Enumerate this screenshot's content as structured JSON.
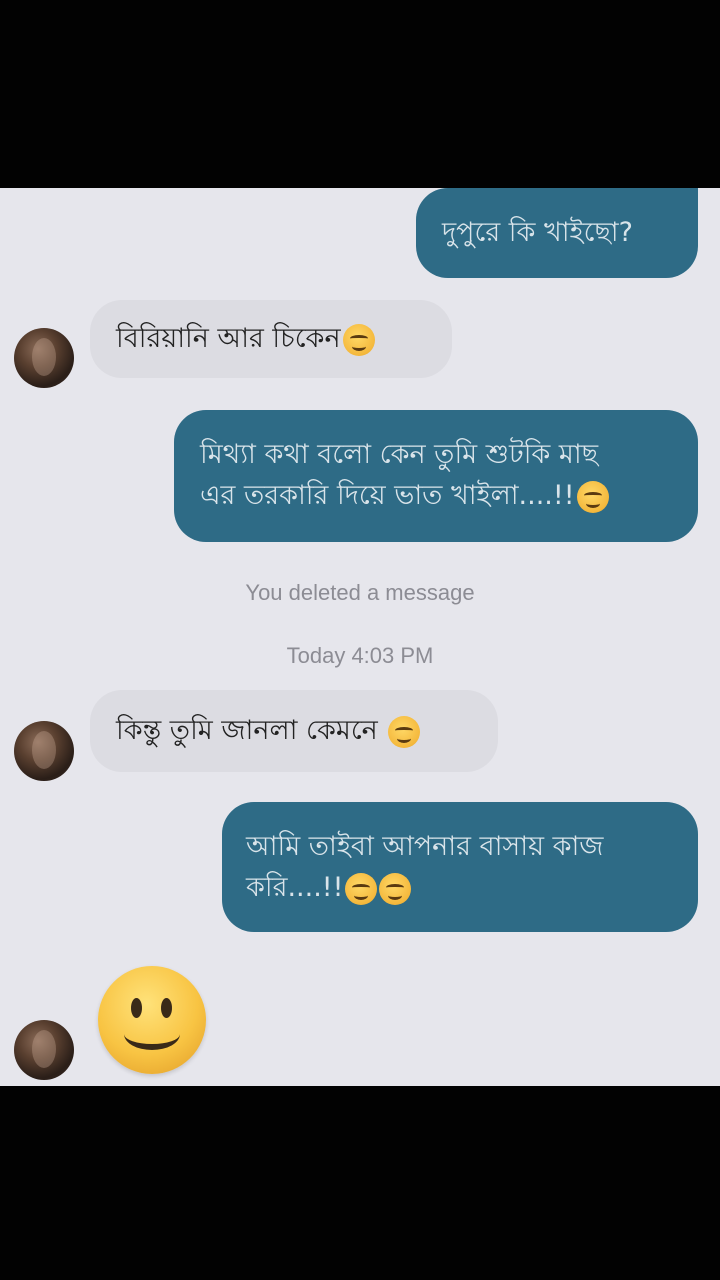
{
  "messages": [
    {
      "direction": "outgoing",
      "text": "দুপুরে কি খাইছো?"
    },
    {
      "direction": "incoming",
      "text": "বিরিয়ানি আর চিকেন",
      "emoji": "smiling-face-icon"
    },
    {
      "direction": "outgoing",
      "line1": "মিথ্যা কথা বলো কেন তুমি শুটকি মাছ",
      "line2": "এর তরকারি দিয়ে ভাত খাইলা....!!",
      "emoji": "unamused-face-icon"
    },
    {
      "direction": "incoming",
      "text": "কিন্তু তুমি জানলা কেমনে ",
      "emoji": "smiling-face-icon"
    },
    {
      "direction": "outgoing",
      "line1": "আমি তাইবা আপনার বাসায় কাজ",
      "line2": "করি....!!",
      "emoji": [
        "crying-face-icon",
        "unamused-face-icon"
      ]
    },
    {
      "direction": "incoming",
      "emoji": "slightly-smiling-face-icon"
    }
  ],
  "system": {
    "deleted_notice": "You deleted a message",
    "timestamp": "Today 4:03 PM"
  },
  "colors": {
    "outgoing_bubble": "#2e6b86",
    "incoming_bubble": "#dcdce2",
    "background": "#e6e6ec"
  }
}
